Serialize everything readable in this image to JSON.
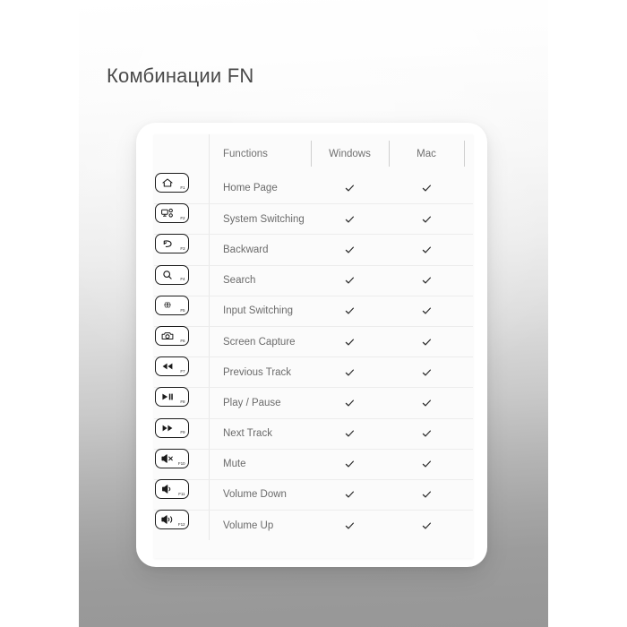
{
  "page": {
    "title": "Комбинации FN",
    "background_top_color": "#ffffff",
    "background_bottom_color": "#979797",
    "side_band_color": "#ffffff",
    "title_color": "#4a4a4a"
  },
  "table": {
    "headers": {
      "functions": "Functions",
      "windows": "Windows",
      "mac": "Mac",
      "extra": ""
    },
    "check_glyph": "check-mark",
    "rows": [
      {
        "fkey": "F1",
        "icon": "home-icon",
        "function": "Home Page",
        "windows": "check",
        "mac": "check"
      },
      {
        "fkey": "F2",
        "icon": "display-switch-icon",
        "function": "System Switching",
        "windows": "check",
        "mac": "check"
      },
      {
        "fkey": "F3",
        "icon": "back-arrow-icon",
        "function": "Backward",
        "windows": "check",
        "mac": "check"
      },
      {
        "fkey": "F4",
        "icon": "search-icon",
        "function": "Search",
        "windows": "check",
        "mac": "check"
      },
      {
        "fkey": "F5",
        "icon": "globe-input-icon",
        "function": "Input Switching",
        "windows": "check",
        "mac": "check"
      },
      {
        "fkey": "F6",
        "icon": "camera-icon",
        "function": "Screen Capture",
        "windows": "check",
        "mac": "check"
      },
      {
        "fkey": "F7",
        "icon": "rewind-icon",
        "function": "Previous Track",
        "windows": "check",
        "mac": "check"
      },
      {
        "fkey": "F8",
        "icon": "play-pause-icon",
        "function": "Play / Pause",
        "windows": "check",
        "mac": "check"
      },
      {
        "fkey": "F9",
        "icon": "fast-forward-icon",
        "function": "Next Track",
        "windows": "check",
        "mac": "check"
      },
      {
        "fkey": "F10",
        "icon": "mute-icon",
        "function": "Mute",
        "windows": "check",
        "mac": "check"
      },
      {
        "fkey": "F11",
        "icon": "volume-down-icon",
        "function": "Volume Down",
        "windows": "check",
        "mac": "check"
      },
      {
        "fkey": "F12",
        "icon": "volume-up-icon",
        "function": "Volume Up",
        "windows": "check",
        "mac": "check"
      }
    ]
  }
}
